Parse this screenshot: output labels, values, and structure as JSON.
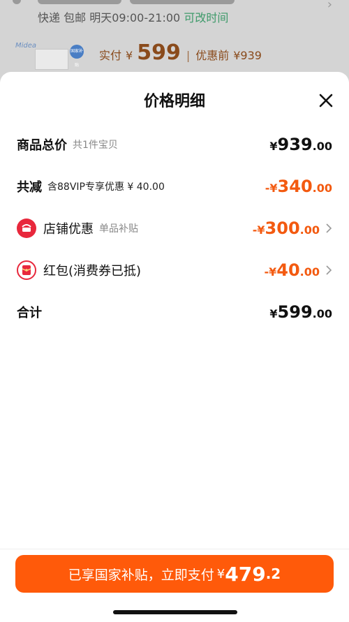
{
  "background": {
    "shipping": {
      "method": "快递",
      "fee": "包邮",
      "time": "明天09:00-21:00",
      "change": "可改时间"
    },
    "product": {
      "brand": "Midea",
      "badge": "国家补贴"
    },
    "price": {
      "paid_label": "实付",
      "currency": "¥",
      "paid_value": "599",
      "separator": "|",
      "original_label": "优惠前",
      "original_value": "¥939"
    }
  },
  "sheet": {
    "title": "价格明细",
    "rows": [
      {
        "label": "商品总价",
        "sub": "共1件宝贝",
        "currency": "¥",
        "int": "939",
        "dec": ".00",
        "color": "#111111"
      },
      {
        "label": "共减",
        "sub": "含88VIP专享优惠 ¥ 40.00",
        "currency": "-¥",
        "int": "340",
        "dec": ".00",
        "color": "#f35a10"
      },
      {
        "label": "店铺优惠",
        "sub": "单品补贴",
        "currency": "-¥",
        "int": "300",
        "dec": ".00",
        "color": "#f35a10",
        "icon": "shop-icon"
      },
      {
        "label": "红包(消费券已抵)",
        "sub": "",
        "currency": "-¥",
        "int": "40",
        "dec": ".00",
        "color": "#f35a10",
        "icon": "red-envelope-icon"
      },
      {
        "label": "合计",
        "sub": "",
        "currency": "¥",
        "int": "599",
        "dec": ".00",
        "color": "#111111"
      }
    ]
  },
  "pay_button": {
    "label": "已享国家补贴，立即支付",
    "currency": "¥",
    "int": "479",
    "dec": ".2",
    "color": "#ff5a0a"
  }
}
